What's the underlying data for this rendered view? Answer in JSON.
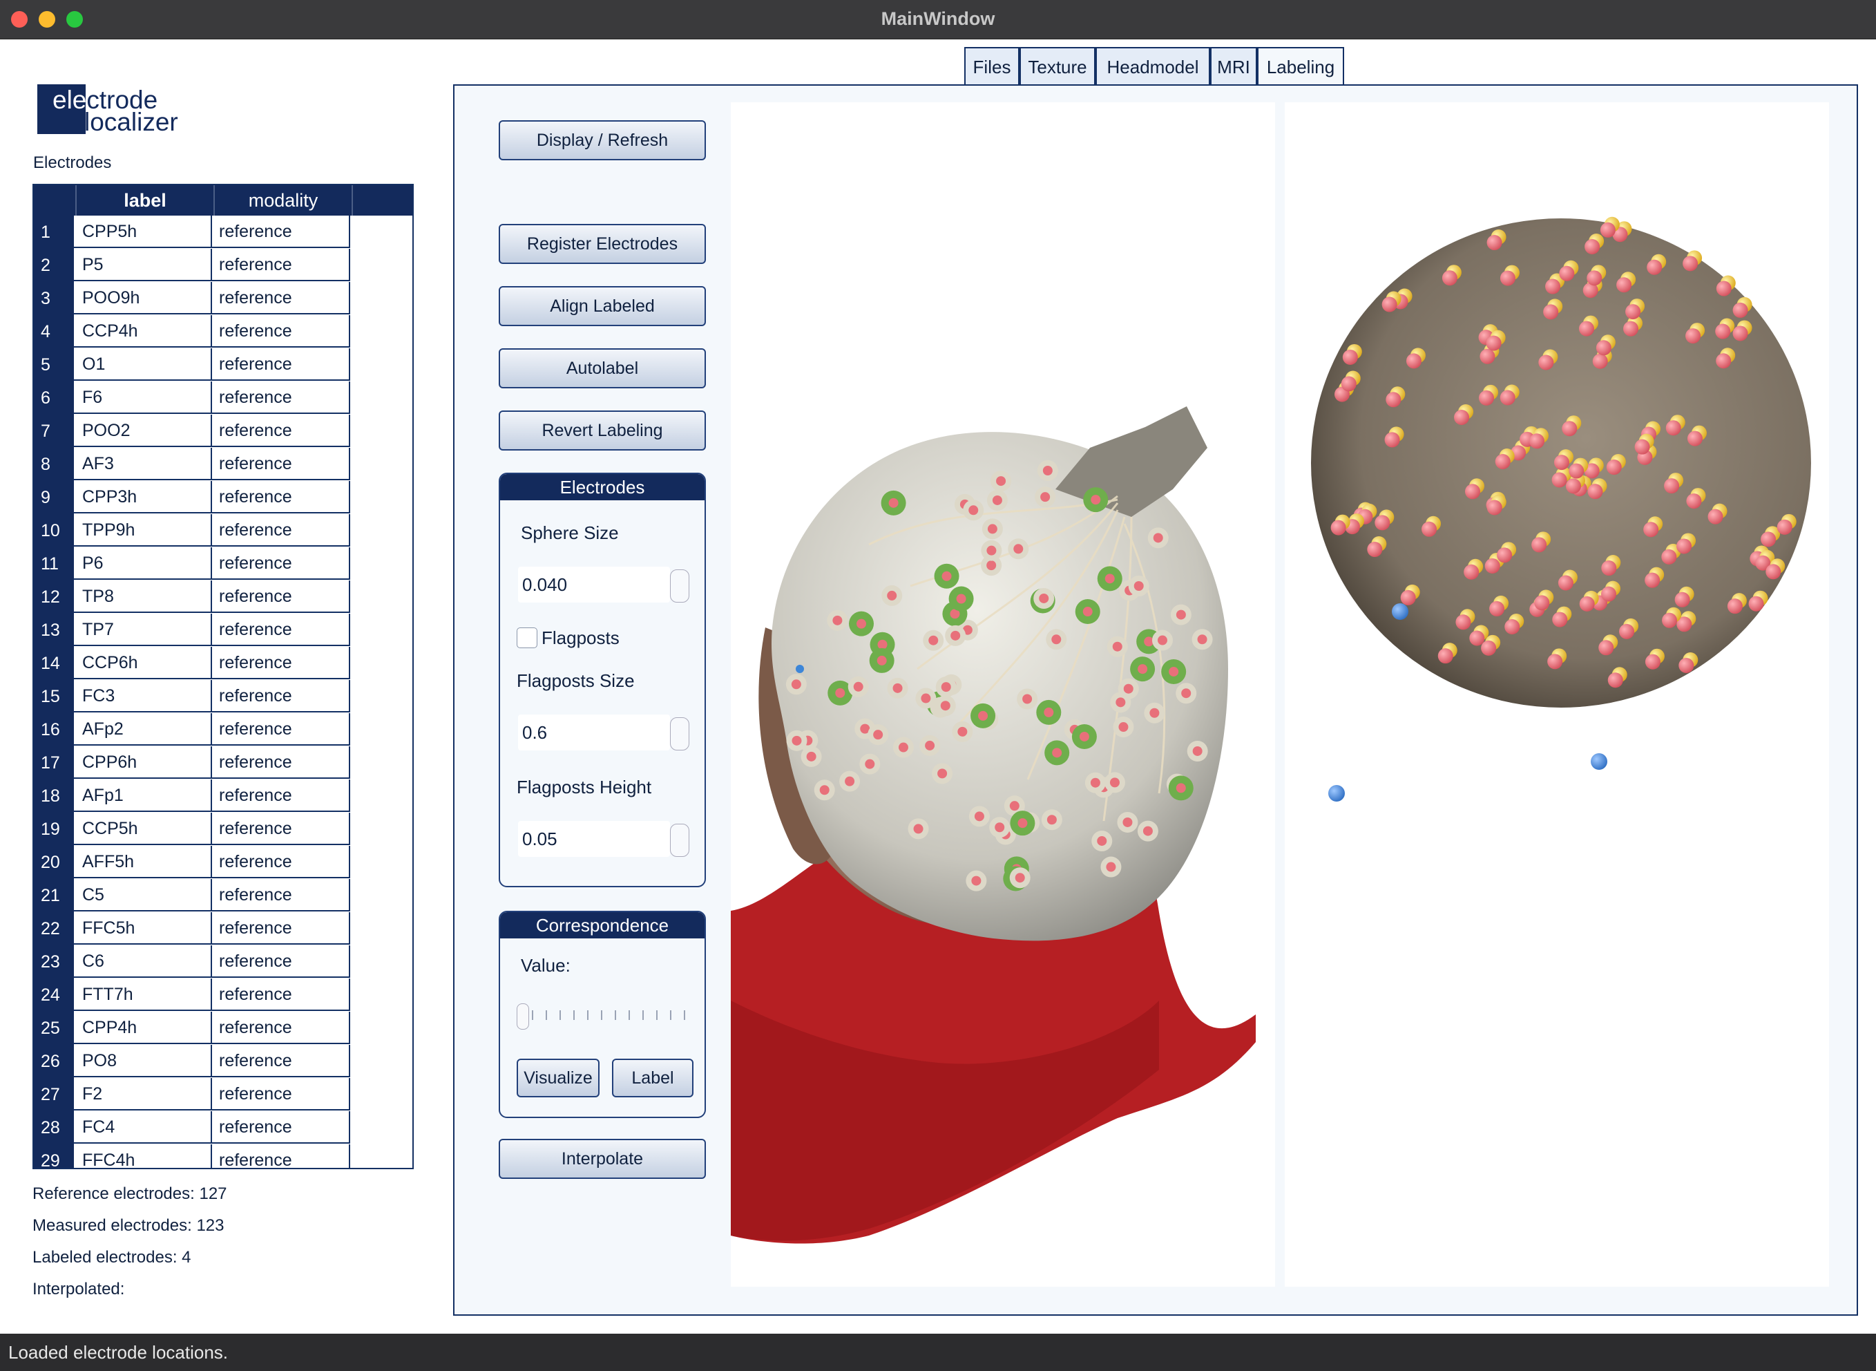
{
  "window": {
    "title": "MainWindow"
  },
  "logo": {
    "line1": "electrode",
    "line2": "localizer"
  },
  "sidebar": {
    "electrodes_label": "Electrodes",
    "table": {
      "headers": [
        "label",
        "modality"
      ],
      "rows": [
        {
          "num": "1",
          "label": "CPP5h",
          "modality": "reference"
        },
        {
          "num": "2",
          "label": "P5",
          "modality": "reference"
        },
        {
          "num": "3",
          "label": "POO9h",
          "modality": "reference"
        },
        {
          "num": "4",
          "label": "CCP4h",
          "modality": "reference"
        },
        {
          "num": "5",
          "label": "O1",
          "modality": "reference"
        },
        {
          "num": "6",
          "label": "F6",
          "modality": "reference"
        },
        {
          "num": "7",
          "label": "POO2",
          "modality": "reference"
        },
        {
          "num": "8",
          "label": "AF3",
          "modality": "reference"
        },
        {
          "num": "9",
          "label": "CPP3h",
          "modality": "reference"
        },
        {
          "num": "10",
          "label": "TPP9h",
          "modality": "reference"
        },
        {
          "num": "11",
          "label": "P6",
          "modality": "reference"
        },
        {
          "num": "12",
          "label": "TP8",
          "modality": "reference"
        },
        {
          "num": "13",
          "label": "TP7",
          "modality": "reference"
        },
        {
          "num": "14",
          "label": "CCP6h",
          "modality": "reference"
        },
        {
          "num": "15",
          "label": "FC3",
          "modality": "reference"
        },
        {
          "num": "16",
          "label": "AFp2",
          "modality": "reference"
        },
        {
          "num": "17",
          "label": "CPP6h",
          "modality": "reference"
        },
        {
          "num": "18",
          "label": "AFp1",
          "modality": "reference"
        },
        {
          "num": "19",
          "label": "CCP5h",
          "modality": "reference"
        },
        {
          "num": "20",
          "label": "AFF5h",
          "modality": "reference"
        },
        {
          "num": "21",
          "label": "C5",
          "modality": "reference"
        },
        {
          "num": "22",
          "label": "FFC5h",
          "modality": "reference"
        },
        {
          "num": "23",
          "label": "C6",
          "modality": "reference"
        },
        {
          "num": "24",
          "label": "FTT7h",
          "modality": "reference"
        },
        {
          "num": "25",
          "label": "CPP4h",
          "modality": "reference"
        },
        {
          "num": "26",
          "label": "PO8",
          "modality": "reference"
        },
        {
          "num": "27",
          "label": "F2",
          "modality": "reference"
        },
        {
          "num": "28",
          "label": "FC4",
          "modality": "reference"
        },
        {
          "num": "29",
          "label": "FFC4h",
          "modality": "reference"
        }
      ]
    },
    "stats": {
      "reference": "Reference electrodes: 127",
      "measured": "Measured electrodes: 123",
      "labeled": "Labeled electrodes: 4",
      "interpolated": "Interpolated:"
    }
  },
  "tabs": [
    {
      "label": "Files",
      "active": false
    },
    {
      "label": "Texture",
      "active": false
    },
    {
      "label": "Headmodel",
      "active": false
    },
    {
      "label": "MRI",
      "active": false
    },
    {
      "label": "Labeling",
      "active": true
    }
  ],
  "controls": {
    "display_refresh": "Display / Refresh",
    "register_electrodes": "Register Electrodes",
    "align_labeled": "Align Labeled",
    "autolabel": "Autolabel",
    "revert_labeling": "Revert Labeling",
    "interpolate": "Interpolate",
    "electrodes_group": {
      "title": "Electrodes",
      "sphere_size_label": "Sphere Size",
      "sphere_size_value": "0.040",
      "flagposts_label": "Flagposts",
      "flagposts_checked": false,
      "flagposts_size_label": "Flagposts Size",
      "flagposts_size_value": "0.6",
      "flagposts_height_label": "Flagposts Height",
      "flagposts_height_value": "0.05"
    },
    "correspondence_group": {
      "title": "Correspondence",
      "value_label": "Value:",
      "slider_value": 0,
      "visualize": "Visualize",
      "label": "Label"
    }
  },
  "status": {
    "message": "Loaded electrode locations."
  },
  "colors": {
    "navy": "#132a5c",
    "panel_bg": "#f4f8fc",
    "marker_red": "#e8707a",
    "marker_yellow": "#f2cf3a",
    "marker_blue": "#3d86d8",
    "sphere": "#847868",
    "shirt": "#b81e23"
  }
}
